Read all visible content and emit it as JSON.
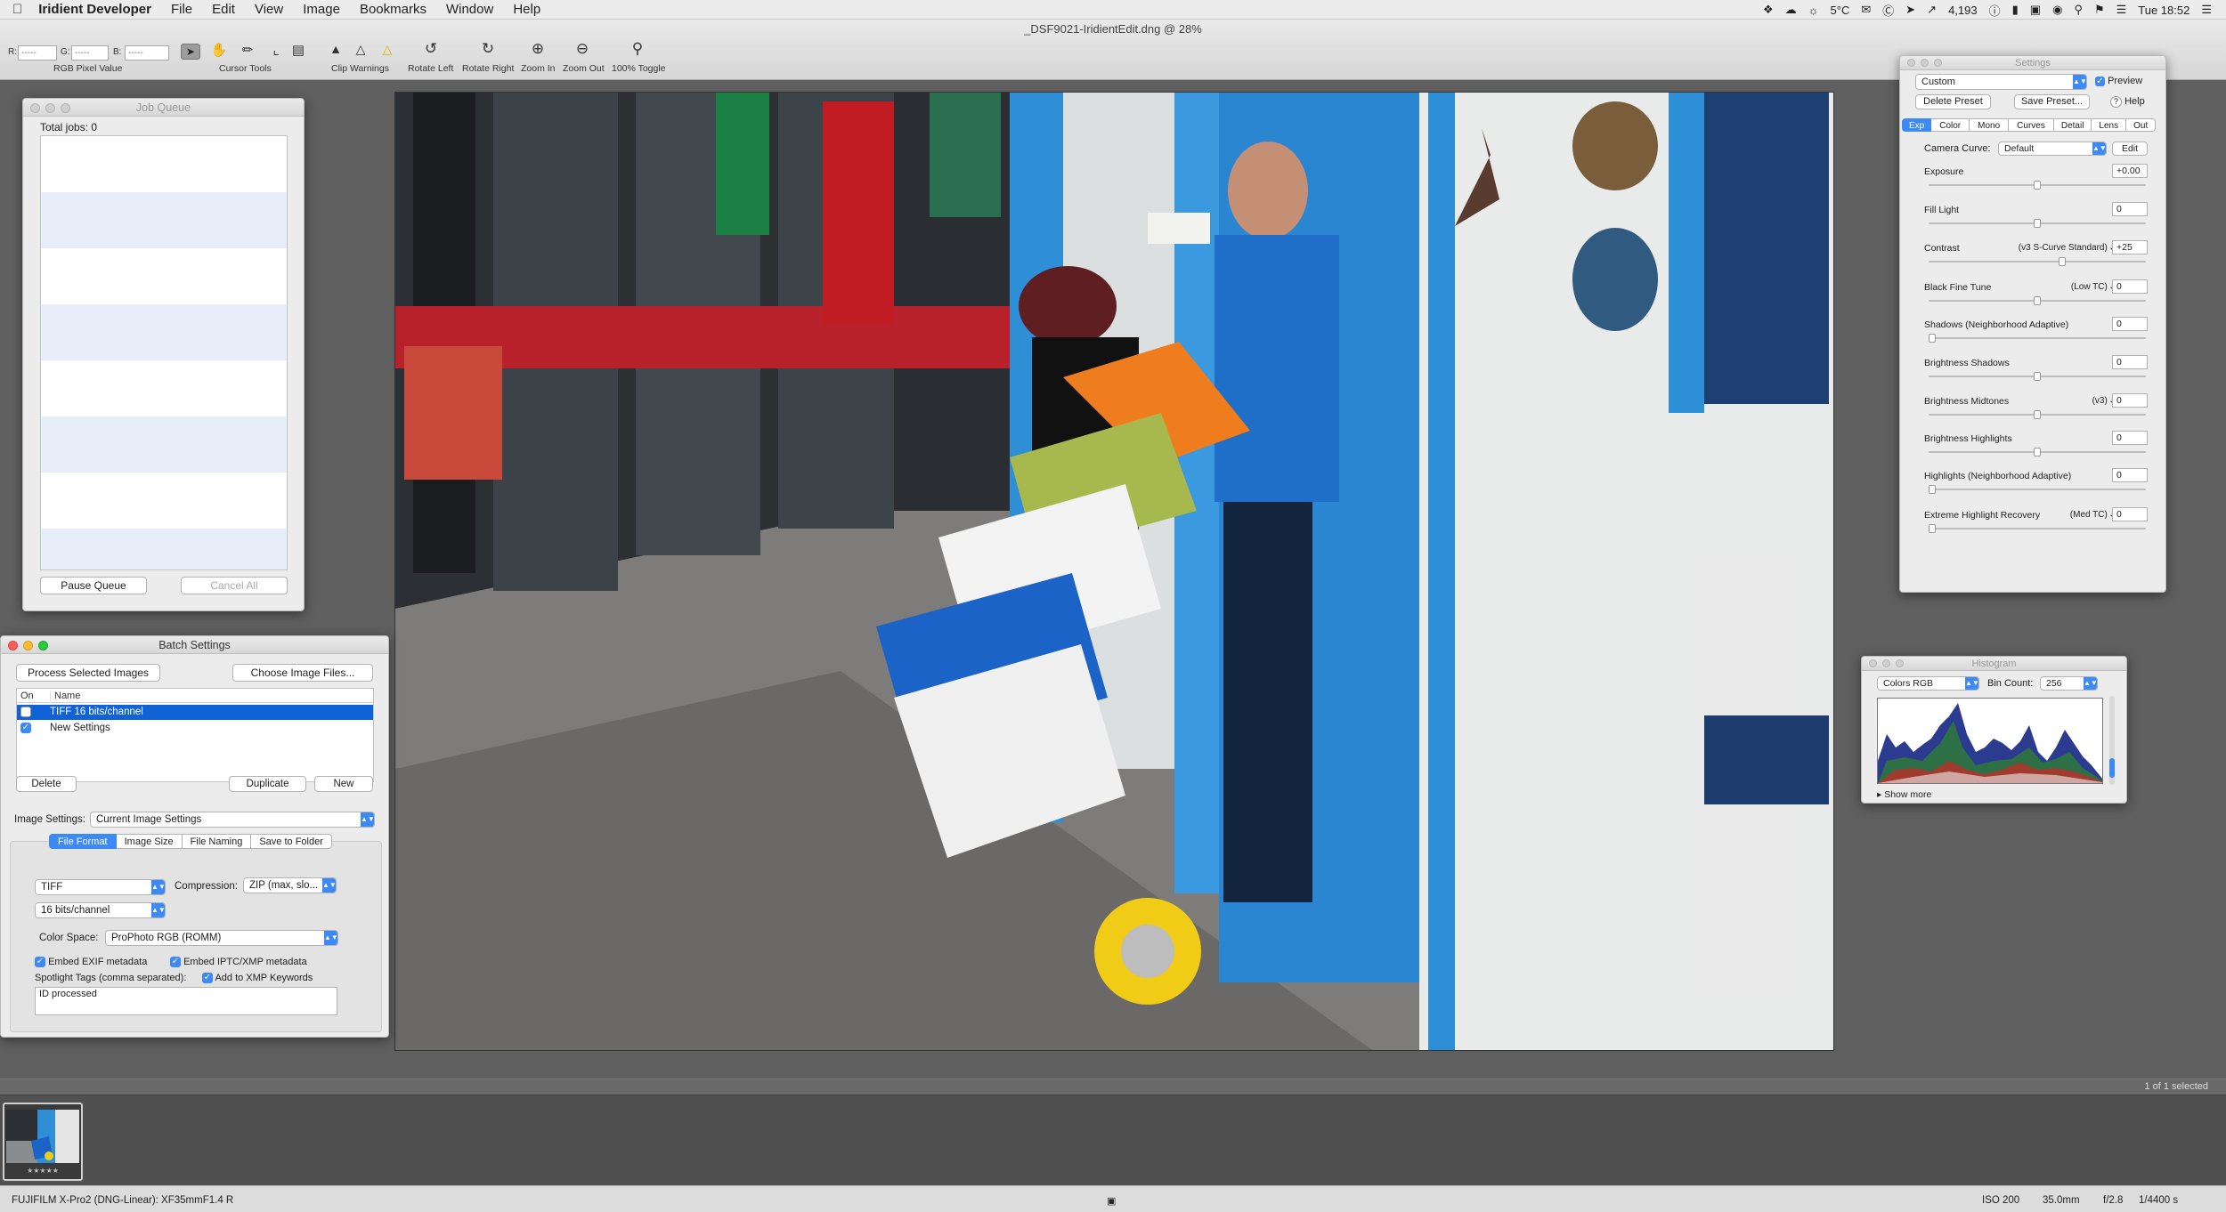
{
  "menubar": {
    "app": "Iridient Developer",
    "items": [
      "File",
      "Edit",
      "View",
      "Image",
      "Bookmarks",
      "Window",
      "Help"
    ],
    "status": {
      "temp": "5°C",
      "counter": "4,193",
      "clock": "Tue 18:52"
    }
  },
  "document": {
    "title": "_DSF9021-IridientEdit.dng @ 28%"
  },
  "toolbar": {
    "rgb": {
      "r_label": "R:",
      "g_label": "G:",
      "b_label": "B:",
      "r_value": "-----",
      "g_value": "-----",
      "b_value": "-----",
      "caption": "RGB Pixel Value"
    },
    "cursor_tools_label": "Cursor Tools",
    "clip_warnings_label": "Clip Warnings",
    "rotate_left_label": "Rotate Left",
    "rotate_right_label": "Rotate Right",
    "zoom_in_label": "Zoom In",
    "zoom_out_label": "Zoom Out",
    "toggle_label": "100% Toggle"
  },
  "job_queue": {
    "title": "Job Queue",
    "total": "Total jobs: 0",
    "pause_label": "Pause Queue",
    "cancel_label": "Cancel All"
  },
  "batch": {
    "title": "Batch Settings",
    "process_label": "Process Selected Images",
    "choose_label": "Choose Image Files...",
    "col_on": "On",
    "col_name": "Name",
    "rows": [
      {
        "name": "TIFF 16 bits/channel",
        "checked": false,
        "selected": true
      },
      {
        "name": "New Settings",
        "checked": true,
        "selected": false
      }
    ],
    "delete_label": "Delete",
    "duplicate_label": "Duplicate",
    "new_label": "New",
    "image_settings_label": "Image Settings:",
    "image_settings_value": "Current Image Settings",
    "tabs": [
      "File Format",
      "Image Size",
      "File Naming",
      "Save to Folder"
    ],
    "format_value": "TIFF",
    "compression_label": "Compression:",
    "compression_value": "ZIP (max, slo...",
    "bits_value": "16 bits/channel",
    "color_space_label": "Color Space:",
    "color_space_value": "ProPhoto RGB (ROMM)",
    "embed_exif": "Embed EXIF metadata",
    "embed_iptc": "Embed IPTC/XMP metadata",
    "spotlight_label": "Spotlight Tags (comma separated):",
    "add_xmp": "Add to XMP Keywords",
    "tags_value": "ID processed"
  },
  "settings": {
    "title": "Settings",
    "preset_value": "Custom",
    "preview_label": "Preview",
    "delete_preset": "Delete Preset",
    "save_preset": "Save Preset...",
    "help_label": "Help",
    "tabs": [
      "Exp",
      "Color",
      "Mono",
      "Curves",
      "Detail",
      "Lens",
      "Out"
    ],
    "camera_curve_label": "Camera Curve:",
    "camera_curve_value": "Default",
    "edit_label": "Edit",
    "rows": [
      {
        "label": "Exposure",
        "mode": "",
        "value": "+0.00",
        "pos": 0.5
      },
      {
        "label": "Fill Light",
        "mode": "",
        "value": "0",
        "pos": 0.5
      },
      {
        "label": "Contrast",
        "mode": "(v3 S-Curve Standard)",
        "value": "+25",
        "pos": 0.62
      },
      {
        "label": "Black Fine Tune",
        "mode": "(Low TC)",
        "value": "0",
        "pos": 0.5
      },
      {
        "label": "Shadows (Neighborhood Adaptive)",
        "mode": "",
        "value": "0",
        "pos": 0.0
      },
      {
        "label": "Brightness Shadows",
        "mode": "",
        "value": "0",
        "pos": 0.5
      },
      {
        "label": "Brightness Midtones",
        "mode": "(v3)",
        "value": "0",
        "pos": 0.5
      },
      {
        "label": "Brightness Highlights",
        "mode": "",
        "value": "0",
        "pos": 0.5
      },
      {
        "label": "Highlights (Neighborhood Adaptive)",
        "mode": "",
        "value": "0",
        "pos": 0.0
      },
      {
        "label": "Extreme Highlight Recovery",
        "mode": "(Med TC)",
        "value": "0",
        "pos": 0.0
      }
    ]
  },
  "histogram": {
    "title": "Histogram",
    "channel_value": "Colors RGB",
    "bin_label": "Bin Count:",
    "bin_value": "256",
    "show_more": "Show more"
  },
  "filmstrip": {
    "selected_count": "1 of 1 selected",
    "rating": "★★★★★"
  },
  "status": {
    "camera": "FUJIFILM X-Pro2 (DNG-Linear): XF35mmF1.4 R",
    "iso": "ISO 200",
    "focal": "35.0mm",
    "aperture": "f/2.8",
    "shutter": "1/4400 s"
  }
}
